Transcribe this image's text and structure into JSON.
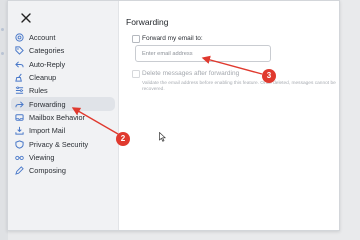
{
  "colors": {
    "accent": "#e0392e",
    "sidebar_bg": "#f1f2f4",
    "active_bg": "#e0e3e8"
  },
  "dialog": {
    "close_icon": "close-icon"
  },
  "sidebar": {
    "items": [
      {
        "label": "Account",
        "icon": "at-icon"
      },
      {
        "label": "Categories",
        "icon": "tag-icon"
      },
      {
        "label": "Auto-Reply",
        "icon": "reply-icon"
      },
      {
        "label": "Cleanup",
        "icon": "broom-icon"
      },
      {
        "label": "Rules",
        "icon": "rules-icon"
      },
      {
        "label": "Forwarding",
        "icon": "forward-icon",
        "active": true
      },
      {
        "label": "Mailbox Behavior",
        "icon": "mailbox-icon"
      },
      {
        "label": "Import Mail",
        "icon": "import-icon"
      },
      {
        "label": "Privacy & Security",
        "icon": "shield-icon"
      },
      {
        "label": "Viewing",
        "icon": "glasses-icon"
      },
      {
        "label": "Composing",
        "icon": "compose-icon"
      }
    ]
  },
  "main": {
    "title": "Forwarding",
    "forward_checkbox_label": "Forward my email to:",
    "forward_checked": false,
    "email_placeholder": "Enter email address",
    "email_value": "",
    "delete_checkbox_label": "Delete messages after forwarding",
    "delete_checked": false,
    "delete_hint": "Validate the email address before enabling this feature. Once deleted, messages cannot be recovered."
  },
  "annotations": [
    {
      "label": "2"
    },
    {
      "label": "3"
    }
  ]
}
